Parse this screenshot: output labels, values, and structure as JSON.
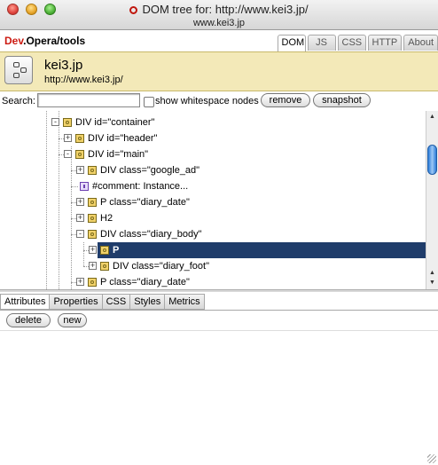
{
  "window": {
    "title": "DOM tree for: http://www.kei3.jp/",
    "subtitle": "www.kei3.jp"
  },
  "brand": {
    "dev": "Dev",
    "rest": ".Opera/tools"
  },
  "tabs": [
    {
      "label": "DOM",
      "active": true
    },
    {
      "label": "JS"
    },
    {
      "label": "CSS"
    },
    {
      "label": "HTTP"
    },
    {
      "label": "About"
    }
  ],
  "site": {
    "title": "kei3.jp",
    "url": "http://www.kei3.jp/"
  },
  "search": {
    "label": "Search:",
    "value": "",
    "show_whitespace_label": "show whitespace nodes",
    "remove_label": "remove",
    "snapshot_label": "snapshot"
  },
  "tree": {
    "rows": [
      {
        "label": "DIV id=\"container\"",
        "depth": 0,
        "toggle": "-",
        "icon": "element-icon"
      },
      {
        "label": "DIV id=\"header\"",
        "depth": 1,
        "toggle": "+",
        "icon": "element-icon"
      },
      {
        "label": "DIV id=\"main\"",
        "depth": 1,
        "toggle": "-",
        "icon": "element-icon"
      },
      {
        "label": "DIV class=\"google_ad\"",
        "depth": 2,
        "toggle": "+",
        "icon": "element-icon"
      },
      {
        "label": "#comment: Instance...",
        "depth": 2,
        "toggle": "",
        "icon": "comment-icon"
      },
      {
        "label": "P class=\"diary_date\"",
        "depth": 2,
        "toggle": "+",
        "icon": "element-icon"
      },
      {
        "label": "H2",
        "depth": 2,
        "toggle": "+",
        "icon": "element-icon"
      },
      {
        "label": "DIV class=\"diary_body\"",
        "depth": 2,
        "toggle": "-",
        "icon": "element-icon"
      },
      {
        "label": "P",
        "depth": 3,
        "toggle": "+",
        "icon": "element-icon",
        "selected": true
      },
      {
        "label": "DIV class=\"diary_foot\"",
        "depth": 3,
        "toggle": "+",
        "icon": "element-icon"
      },
      {
        "label": "P class=\"diary_date\"",
        "depth": 2,
        "toggle": "+",
        "icon": "element-icon"
      }
    ]
  },
  "subtabs": [
    {
      "label": "Attributes",
      "active": true
    },
    {
      "label": "Properties"
    },
    {
      "label": "CSS"
    },
    {
      "label": "Styles"
    },
    {
      "label": "Metrics"
    }
  ],
  "panel_buttons": {
    "delete_label": "delete",
    "new_label": "new"
  },
  "colors": {
    "selected_row": "#1f3c6a",
    "infobar": "#f3e9b8",
    "brand_red": "#cc1a12"
  }
}
